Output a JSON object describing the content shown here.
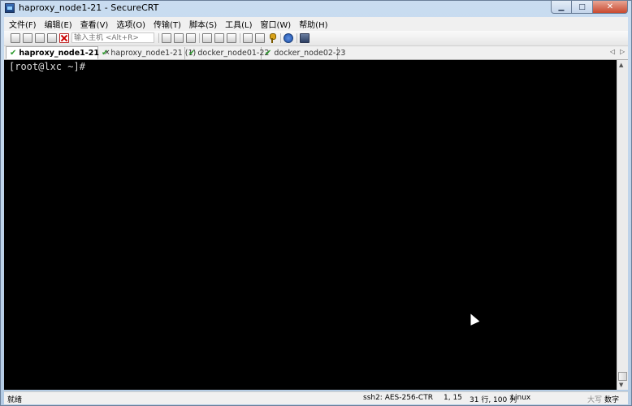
{
  "window": {
    "title": "haproxy_node1-21 - SecureCRT"
  },
  "window_controls": {
    "minimize": "▁",
    "maximize": "□",
    "close": "✕"
  },
  "menu": [
    "文件(F)",
    "编辑(E)",
    "查看(V)",
    "选项(O)",
    "传输(T)",
    "脚本(S)",
    "工具(L)",
    "窗口(W)",
    "帮助(H)"
  ],
  "toolbar": {
    "quick_connect_placeholder": "输入主机 <Alt+R>"
  },
  "tabs": [
    {
      "label": "haproxy_node1-21",
      "active": true,
      "close": "×"
    },
    {
      "label": "haproxy_node1-21 (1)",
      "active": false
    },
    {
      "label": "docker_node01-22",
      "active": false
    },
    {
      "label": "docker_node02-23",
      "active": false
    }
  ],
  "tab_scroll": {
    "left": "◁",
    "right": "▷"
  },
  "terminal": {
    "prompt": "[root@lxc ~]#"
  },
  "status": {
    "ready": "就绪",
    "protocol": "ssh2: AES-256-CTR",
    "cursor_pos": "1,  15",
    "size": "31 行, 100 列",
    "os": "Linux",
    "caps": "大写",
    "num": "数字"
  },
  "colors": {
    "check": "#2e9a2e",
    "terminal_bg": "#000000",
    "terminal_fg": "#d8d8d8"
  }
}
